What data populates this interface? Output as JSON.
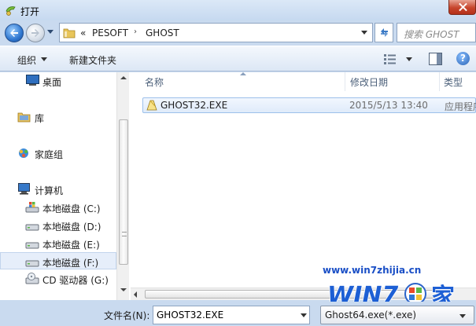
{
  "window": {
    "title": "打开"
  },
  "address": {
    "overflow": "«",
    "path": [
      "PESOFT",
      "GHOST"
    ],
    "separator": "›"
  },
  "search": {
    "placeholder": "搜索 GHOST"
  },
  "toolbar": {
    "organize_label": "组织",
    "new_folder_label": "新建文件夹",
    "help_label": "?"
  },
  "nav": {
    "items": [
      {
        "label": "桌面",
        "icon": "desktop-icon"
      },
      {
        "label": "库",
        "icon": "library-icon"
      },
      {
        "label": "家庭组",
        "icon": "homegroup-icon"
      },
      {
        "label": "计算机",
        "icon": "computer-icon"
      },
      {
        "label": "本地磁盘 (C:)",
        "icon": "system-drive-icon"
      },
      {
        "label": "本地磁盘 (D:)",
        "icon": "drive-icon"
      },
      {
        "label": "本地磁盘 (E:)",
        "icon": "drive-icon"
      },
      {
        "label": "本地磁盘 (F:)",
        "icon": "drive-icon",
        "selected": true
      },
      {
        "label": "CD 驱动器 (G:)",
        "icon": "cd-drive-icon"
      }
    ]
  },
  "files": {
    "columns": {
      "name": "名称",
      "date": "修改日期",
      "type": "类型"
    },
    "rows": [
      {
        "name": "GHOST32.EXE",
        "date": "2015/5/13 13:40",
        "type": "应用程序"
      }
    ]
  },
  "bottom": {
    "filename_label": "文件名(N):",
    "filename_value": "GHOST32.EXE",
    "filetype_value": "Ghost64.exe(*.exe)"
  },
  "watermark": {
    "url": "www.win7zhijia.cn",
    "logo_text": "WIN7",
    "logo_suffix": "家"
  },
  "colors": {
    "accent": "#2f77d0",
    "selection": "#dfebfa",
    "link": "#1a4fc6",
    "close": "#c7452c"
  }
}
